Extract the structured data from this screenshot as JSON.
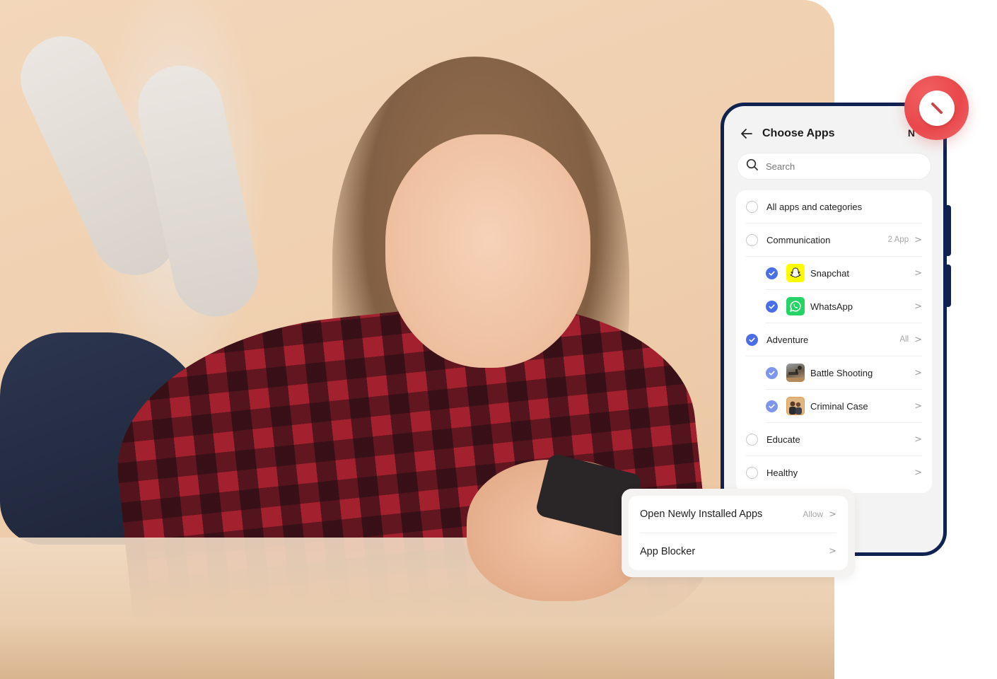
{
  "hero_photo": {
    "description": "Smiling girl lying on a bed in a red plaid shirt, using a smartphone",
    "icon": "photo-illustration"
  },
  "phone": {
    "header": {
      "back_icon": "arrow-left-icon",
      "title": "Choose Apps",
      "next_label": "N"
    },
    "search": {
      "icon": "search-icon",
      "placeholder": "Search",
      "value": ""
    },
    "list": [
      {
        "label": "All apps and categories",
        "checked": false,
        "meta": "",
        "chevron": false,
        "child": false
      },
      {
        "label": "Communication",
        "checked": false,
        "meta": "2 App",
        "chevron": true,
        "child": false
      },
      {
        "label": "Snapchat",
        "checked": true,
        "meta": "",
        "chevron": true,
        "child": true,
        "app_icon": "snapchat-icon",
        "icon_color": "#FFFC00"
      },
      {
        "label": "WhatsApp",
        "checked": true,
        "meta": "",
        "chevron": true,
        "child": true,
        "app_icon": "whatsapp-icon",
        "icon_color": "#25D366"
      },
      {
        "label": "Adventure",
        "checked": true,
        "meta": "All",
        "chevron": true,
        "child": false
      },
      {
        "label": "Battle Shooting",
        "checked": true,
        "meta": "",
        "chevron": true,
        "child": true,
        "app_icon": "battle-shooting-icon"
      },
      {
        "label": "Criminal Case",
        "checked": true,
        "meta": "",
        "chevron": true,
        "child": true,
        "app_icon": "criminal-case-icon"
      },
      {
        "label": "Educate",
        "checked": false,
        "meta": "",
        "chevron": true,
        "child": false
      },
      {
        "label": "Healthy",
        "checked": false,
        "meta": "",
        "chevron": true,
        "child": false
      }
    ]
  },
  "block_badge": {
    "icon": "block-icon",
    "color": "#E9474B"
  },
  "settings_card": {
    "rows": [
      {
        "label": "Open Newly Installed Apps",
        "meta": "Allow"
      },
      {
        "label": "App Blocker",
        "meta": ""
      }
    ]
  },
  "colors": {
    "phone_frame": "#0F2250",
    "check_accent": "#4A6EE8",
    "check_accent_light": "#7D95EC",
    "badge_red": "#E9474B"
  }
}
